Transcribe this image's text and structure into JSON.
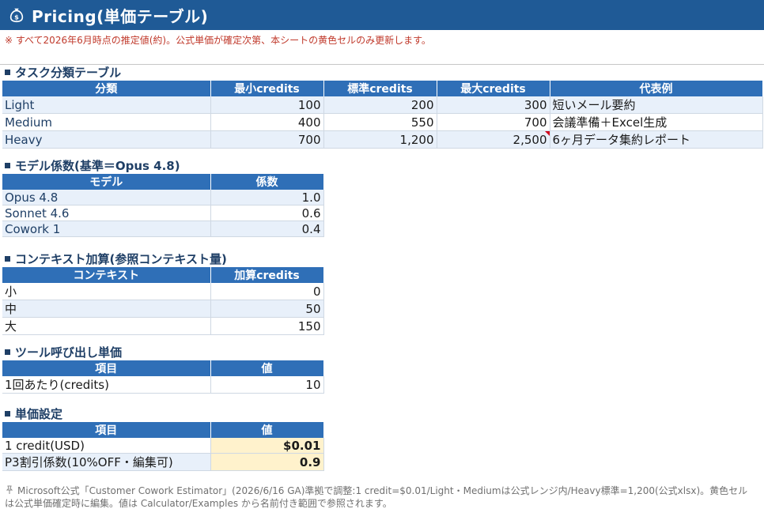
{
  "header": {
    "title": "Pricing(単価テーブル)"
  },
  "note": "※ すべて2026年6月時点の推定値(約)。公式単価が確定次第、本シートの黄色セルのみ更新します。",
  "sections": {
    "task": {
      "title": "タスク分類テーブル",
      "columns": [
        "分類",
        "最小credits",
        "標準credits",
        "最大credits",
        "代表例"
      ],
      "rows": [
        [
          "Light",
          "100",
          "200",
          "300",
          "短いメール要約"
        ],
        [
          "Medium",
          "400",
          "550",
          "700",
          "会議準備＋Excel生成"
        ],
        [
          "Heavy",
          "700",
          "1,200",
          "2,500",
          "6ヶ月データ集約レポート"
        ]
      ]
    },
    "model": {
      "title": "モデル係数(基準＝Opus 4.8)",
      "columns": [
        "モデル",
        "係数"
      ],
      "rows": [
        [
          "Opus 4.8",
          "1.0"
        ],
        [
          "Sonnet 4.6",
          "0.6"
        ],
        [
          "Cowork 1",
          "0.4"
        ]
      ]
    },
    "context": {
      "title": "コンテキスト加算(参照コンテキスト量)",
      "columns": [
        "コンテキスト",
        "加算credits"
      ],
      "rows": [
        [
          "小",
          "0"
        ],
        [
          "中",
          "50"
        ],
        [
          "大",
          "150"
        ]
      ]
    },
    "tool": {
      "title": "ツール呼び出し単価",
      "columns": [
        "項目",
        "値"
      ],
      "rows": [
        [
          "1回あたり(credits)",
          "10"
        ]
      ]
    },
    "unit": {
      "title": "単価設定",
      "columns": [
        "項目",
        "値"
      ],
      "rows": [
        [
          "1 credit(USD)",
          "$0.01"
        ],
        [
          "P3割引係数(10%OFF・編集可)",
          "0.9"
        ]
      ]
    }
  },
  "footer": {
    "icon": "pushpin-icon",
    "text": "Microsoft公式「Customer Cowork Estimator」(2026/6/16 GA)準拠で調整:1 credit=$0.01/Light・Mediumは公式レンジ内/Heavy標準=1,200(公式xlsx)。黄色セルは公式単価確定時に編集。値は Calculator/Examples から名前付き範囲で参照されます。"
  },
  "colors": {
    "header_bg": "#1f5a96",
    "table_header": "#2f6fb7",
    "alt_row": "#e8f0fa",
    "input_cell": "#fff2cc",
    "note_red": "#c0392b"
  }
}
